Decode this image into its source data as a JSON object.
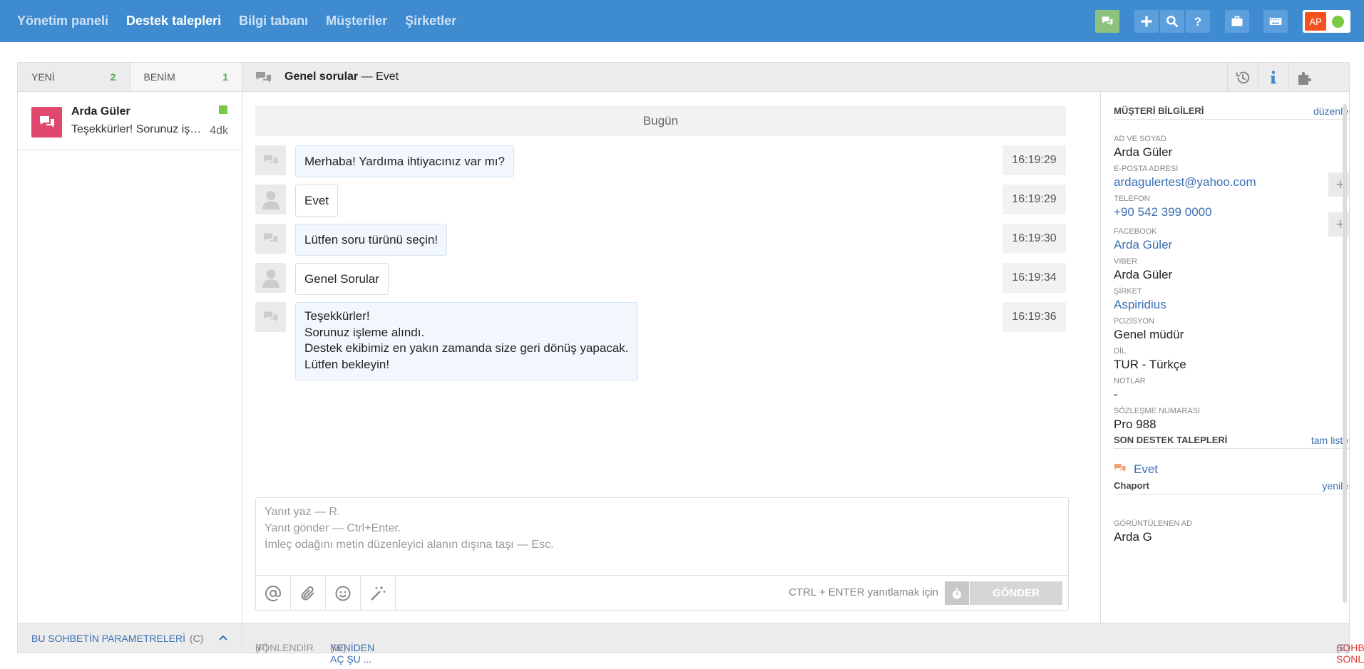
{
  "nav": [
    "Yönetim paneli",
    "Destek talepleri",
    "Bilgi tabanı",
    "Müşteriler",
    "Şirketler"
  ],
  "nav_active": 1,
  "user_initials": "AP",
  "tabs": [
    {
      "label": "YENİ",
      "count": "2"
    },
    {
      "label": "BENİM",
      "count": "1"
    }
  ],
  "conversation_item": {
    "name": "Arda Güler",
    "preview": "Teşekkürler! Sorunuz işleme alındı.",
    "time": "4dk"
  },
  "left_footer": {
    "label": "BU SOHBETİN PARAMETRELERİ",
    "key": "(C)"
  },
  "chat_header": {
    "topic": "Genel sorular",
    "separator": " — ",
    "subject": "Evet"
  },
  "day_label": "Bugün",
  "messages": [
    {
      "from": "bot",
      "text": "Merhaba! Yardıma ihtiyacınız var mı?",
      "time": "16:19:29"
    },
    {
      "from": "user",
      "text": "Evet",
      "time": "16:19:29"
    },
    {
      "from": "bot",
      "text": "Lütfen soru türünü seçin!",
      "time": "16:19:30"
    },
    {
      "from": "user",
      "text": "Genel Sorular",
      "time": "16:19:34"
    },
    {
      "from": "bot",
      "lines": [
        "Teşekkürler!",
        "Sorunuz işleme alındı.",
        "Destek ekibimiz en yakın zamanda size geri dönüş yapacak.",
        "Lütfen bekleyin!"
      ],
      "time": "16:19:36"
    }
  ],
  "composer": {
    "placeholder": "Yanıt yaz — R.\nYanıt gönder — Ctrl+Enter.\nİmleç odağını metin düzenleyici alanın dışına taşı — Esc.",
    "hint": "CTRL + ENTER yanıtlamak için",
    "send": "GÖNDER"
  },
  "chat_footer": {
    "route": "YÖNLENDİR",
    "route_key": "(F)",
    "reopen": "YENİDEN AÇ ŞU ...",
    "reopen_key": "(W)",
    "end": "SOHBETİ SONLANDIR",
    "end_key": "(E)"
  },
  "customer": {
    "section_title": "MÜŞTERİ BİLGİLERİ",
    "edit": "düzenle",
    "fields": [
      {
        "label": "AD VE SOYAD",
        "value": "Arda Güler",
        "link": false
      },
      {
        "label": "E-POSTA ADRESİ",
        "value": "ardagulertest@yahoo.com",
        "link": true
      },
      {
        "label": "TELEFON",
        "value": "+90 542 399 0000",
        "link": true
      },
      {
        "label": "FACEBOOK",
        "value": "Arda Güler",
        "link": true
      },
      {
        "label": "VIBER",
        "value": "Arda Güler",
        "link": false
      },
      {
        "label": "ŞİRKET",
        "value": "Aspiridius",
        "link": true
      },
      {
        "label": "POZİSYON",
        "value": "Genel müdür",
        "link": false
      },
      {
        "label": "DİL",
        "value": "TUR - Türkçe",
        "link": false
      },
      {
        "label": "NOTLAR",
        "value": "-",
        "link": false
      },
      {
        "label": "SÖZLEŞME NUMARASI",
        "value": "Pro 988",
        "link": false
      }
    ]
  },
  "recent": {
    "title": "SON DESTEK TALEPLERİ",
    "link": "tam liste",
    "item": "Evet"
  },
  "chaport": {
    "title": "Chaport",
    "link": "yenile",
    "label": "GÖRÜNTÜLENEN AD",
    "value": "Arda G"
  },
  "colors": {
    "header": "#3f8bd0",
    "accent_link": "#3b6fb3",
    "danger": "#e53935",
    "status": "#7ac943",
    "conv_icon": "#e0486e"
  }
}
